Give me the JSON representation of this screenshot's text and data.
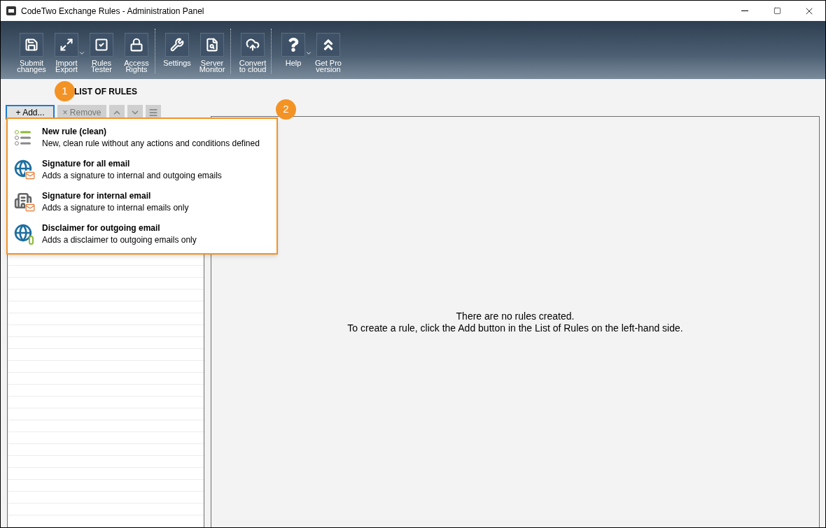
{
  "window": {
    "title": "CodeTwo Exchange Rules - Administration Panel"
  },
  "toolbar": [
    {
      "kind": "save",
      "label": "Submit changes",
      "has_menu": false
    },
    {
      "kind": "import",
      "label": "Import Export",
      "has_menu": true
    },
    {
      "kind": "tester",
      "label": "Rules Tester",
      "has_menu": false
    },
    {
      "kind": "lock",
      "label": "Access Rights",
      "has_menu": false
    },
    {
      "kind": "separator"
    },
    {
      "kind": "wrench",
      "label": "Settings",
      "has_menu": false
    },
    {
      "kind": "monitor",
      "label": "Server Monitor",
      "has_menu": false
    },
    {
      "kind": "separator"
    },
    {
      "kind": "cloud",
      "label": "Convert to cloud",
      "has_menu": false
    },
    {
      "kind": "separator"
    },
    {
      "kind": "help",
      "label": "Help",
      "has_menu": true
    },
    {
      "kind": "pro",
      "label": "Get Pro version",
      "has_menu": false
    }
  ],
  "list_panel": {
    "title": "LIST OF RULES",
    "buttons": [
      {
        "kind": "add",
        "label": "+ Add...",
        "disabled": false,
        "selected": true
      },
      {
        "kind": "remove",
        "label": "× Remove",
        "disabled": true,
        "selected": false
      },
      {
        "kind": "up",
        "disabled": true,
        "selected": false
      },
      {
        "kind": "down",
        "disabled": true,
        "selected": false
      },
      {
        "kind": "menu",
        "disabled": true,
        "selected": false
      }
    ]
  },
  "add_menu": [
    {
      "kind": "clean",
      "title": "New rule (clean)",
      "description": "New, clean rule without any actions and conditions defined"
    },
    {
      "kind": "signature_all",
      "title": "Signature for all email",
      "description": "Adds a signature to internal and outgoing emails"
    },
    {
      "kind": "signature_internal",
      "title": "Signature for internal email",
      "description": "Adds a signature to internal emails only"
    },
    {
      "kind": "disclaimer",
      "title": "Disclaimer for outgoing email",
      "description": "Adds a disclaimer to outgoing emails only"
    }
  ],
  "callouts": [
    "1",
    "2"
  ],
  "empty_state": [
    "There are no rules created.",
    "To create a rule, click the Add button in the List of Rules on the left-hand side."
  ]
}
